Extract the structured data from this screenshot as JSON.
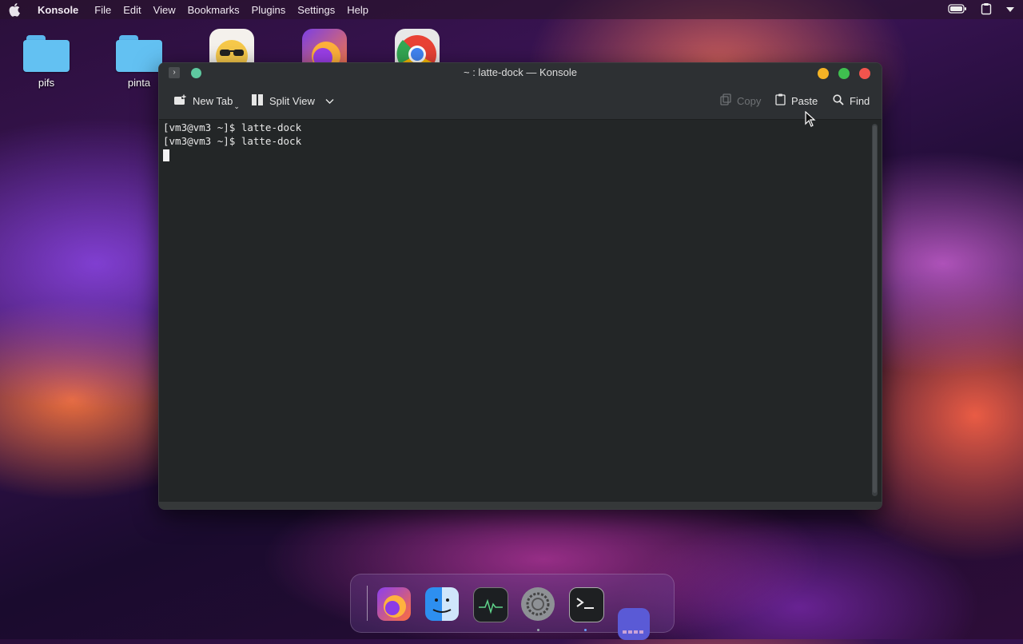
{
  "menubar": {
    "app_name": "Konsole",
    "items": [
      "File",
      "Edit",
      "View",
      "Bookmarks",
      "Plugins",
      "Settings",
      "Help"
    ]
  },
  "desktop": {
    "icons": [
      {
        "label": "pifs",
        "icon": "folder-icon"
      },
      {
        "label": "pinta",
        "icon": "folder-icon"
      }
    ]
  },
  "window": {
    "title": "~ : latte-dock — Konsole",
    "toolbar": {
      "new_tab": "New Tab",
      "split_view": "Split View",
      "copy": "Copy",
      "paste": "Paste",
      "find": "Find"
    },
    "terminal_lines": [
      "[vm3@vm3 ~]$ latte-dock",
      "[vm3@vm3 ~]$ latte-dock"
    ]
  },
  "colors": {
    "window_bg": "#232627",
    "toolbar_bg": "#2d3033",
    "minimize": "#f5b325",
    "maximize": "#3fc04f",
    "close": "#f2544d",
    "folder": "#63c1f2"
  },
  "dock": {
    "items": [
      "firefox-icon",
      "finder-icon",
      "activity-monitor-icon",
      "system-settings-icon",
      "terminal-icon",
      "dock-launcher-icon"
    ]
  }
}
